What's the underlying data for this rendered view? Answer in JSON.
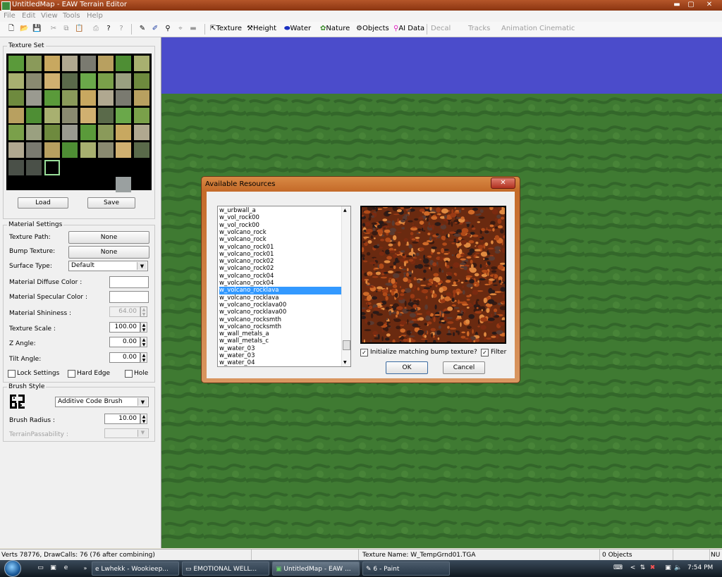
{
  "window": {
    "title": "UntitledMap - EAW Terrain Editor",
    "minimize": "▬",
    "close": "✕"
  },
  "menu": [
    "File",
    "Edit",
    "View",
    "Tools",
    "Help"
  ],
  "toolbar": {
    "tools": [
      "Texture",
      "Height",
      "Water",
      "Nature",
      "Objects",
      "AI Data"
    ],
    "disabled_tools": [
      "Decal",
      "Tracks",
      "Animation",
      "Cinematic"
    ]
  },
  "texture_set": {
    "title": "Texture Set",
    "load": "Load",
    "save": "Save"
  },
  "material_settings": {
    "title": "Material Settings",
    "texture_path_label": "Texture Path:",
    "texture_path_value": "None",
    "bump_texture_label": "Bump Texture:",
    "bump_texture_value": "None",
    "surface_type_label": "Surface Type:",
    "surface_type_value": "Default",
    "diffuse_label": "Material Diffuse Color :",
    "specular_label": "Material Specular Color :",
    "shininess_label": "Material Shininess :",
    "shininess_value": "64.00",
    "texture_scale_label": "Texture Scale :",
    "texture_scale_value": "100.00",
    "z_angle_label": "Z Angle:",
    "z_angle_value": "0.00",
    "tilt_angle_label": "Tilt Angle:",
    "tilt_angle_value": "0.00",
    "lock_settings": "Lock Settings",
    "hard_edge": "Hard Edge",
    "hole": "Hole"
  },
  "brush_style": {
    "title": "Brush Style",
    "brush_value": "Additive Code Brush",
    "radius_label": "Brush Radius :",
    "radius_value": "10.00",
    "passability_label": "TerrainPassability :"
  },
  "dialog": {
    "title": "Available Resources",
    "items": [
      "w_urbwall_a",
      "w_vol_rock00",
      "w_vol_rock00",
      "w_volcano_rock",
      "w_volcano_rock",
      "w_volcano_rock01",
      "w_volcano_rock01",
      "w_volcano_rock02",
      "w_volcano_rock02",
      "w_volcano_rock04",
      "w_volcano_rock04",
      "w_volcano_rocklava",
      "w_volcano_rocklava",
      "w_volcano_rocklava00",
      "w_volcano_rocklava00",
      "w_volcano_rocksmth",
      "w_volcano_rocksmth",
      "w_wall_metals_a",
      "w_wall_metals_c",
      "w_water_03",
      "w_water_03",
      "w_water_04"
    ],
    "selected_index": 11,
    "init_bump_label": "Initialize matching bump texture?",
    "init_bump_checked": true,
    "filter_label": "Filter",
    "filter_checked": true,
    "ok": "OK",
    "cancel": "Cancel"
  },
  "status": {
    "verts": "Verts 78776, DrawCalls: 76 (76 after combining)",
    "texture_name": "Texture Name: W_TempGrnd01.TGA",
    "objects": "0 Objects",
    "num": "NU"
  },
  "taskbar": {
    "tasks": [
      "Lwhekk - Wookieep...",
      "EMOTIONAL WELL...",
      "UntitledMap - EAW ...",
      "6 - Paint"
    ],
    "active_index": 2,
    "time": "7:54 PM"
  }
}
